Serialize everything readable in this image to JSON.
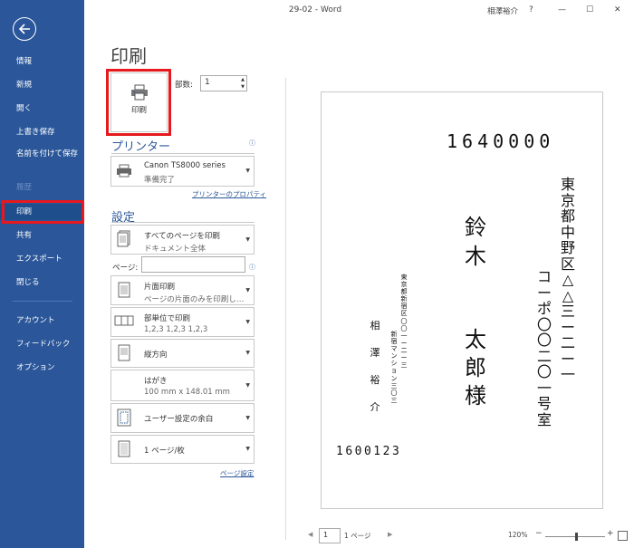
{
  "window": {
    "title": "29-02 - Word",
    "user": "相澤裕介",
    "help": "?",
    "minimize": "—",
    "restore": "☐",
    "close": "✕"
  },
  "sidebar": {
    "items": [
      {
        "label": "情報"
      },
      {
        "label": "新規"
      },
      {
        "label": "開く"
      },
      {
        "label": "上書き保存"
      },
      {
        "label": "名前を付けて保存"
      },
      {
        "label": "履歴"
      },
      {
        "label": "印刷"
      },
      {
        "label": "共有"
      },
      {
        "label": "エクスポート"
      },
      {
        "label": "閉じる"
      },
      {
        "label": "アカウント"
      },
      {
        "label": "フィードバック"
      },
      {
        "label": "オプション"
      }
    ]
  },
  "print": {
    "title": "印刷",
    "button_label": "印刷",
    "copies_label": "部数:",
    "copies_value": "1",
    "printer_heading": "プリンター",
    "printer_name": "Canon TS8000 series",
    "printer_status": "準備完了",
    "printer_properties": "プリンターのプロパティ",
    "settings_heading": "設定",
    "settings": [
      {
        "main": "すべてのページを印刷",
        "sub": "ドキュメント全体"
      },
      {
        "main": "片面印刷",
        "sub": "ページの片面のみを印刷し…"
      },
      {
        "main": "部単位で印刷",
        "sub": "1,2,3    1,2,3    1,2,3"
      },
      {
        "main": "縦方向",
        "sub": ""
      },
      {
        "main": "はがき",
        "sub": "100 mm x 148.01 mm"
      },
      {
        "main": "ユーザー設定の余白",
        "sub": ""
      },
      {
        "main": "1 ページ/枚",
        "sub": ""
      }
    ],
    "pages_label": "ページ:",
    "pages_value": "",
    "page_setup": "ページ設定",
    "info_icon": "ⓘ"
  },
  "preview": {
    "recipient_zip": "1640000",
    "recipient_address_1": "東京都中野区△△三ー二ー一",
    "recipient_address_2": "コーポ〇〇二〇一号室",
    "recipient_name_1": "鈴木",
    "recipient_name_2": "太郎様",
    "sender_address_1": "東京都新宿区〇〇一ー二ー三",
    "sender_address_2": "新宿マンション三〇三",
    "sender_name": "相澤裕介",
    "sender_zip": "1600123"
  },
  "statusbar": {
    "page_current": "1",
    "page_total": "1 ページ",
    "zoom": "120%",
    "prev": "◀",
    "next": "▶",
    "zoom_minus": "−",
    "zoom_plus": "+"
  },
  "colors": {
    "rail": "#2b579a",
    "highlight": "#e5191e",
    "accent": "#2b579a"
  }
}
